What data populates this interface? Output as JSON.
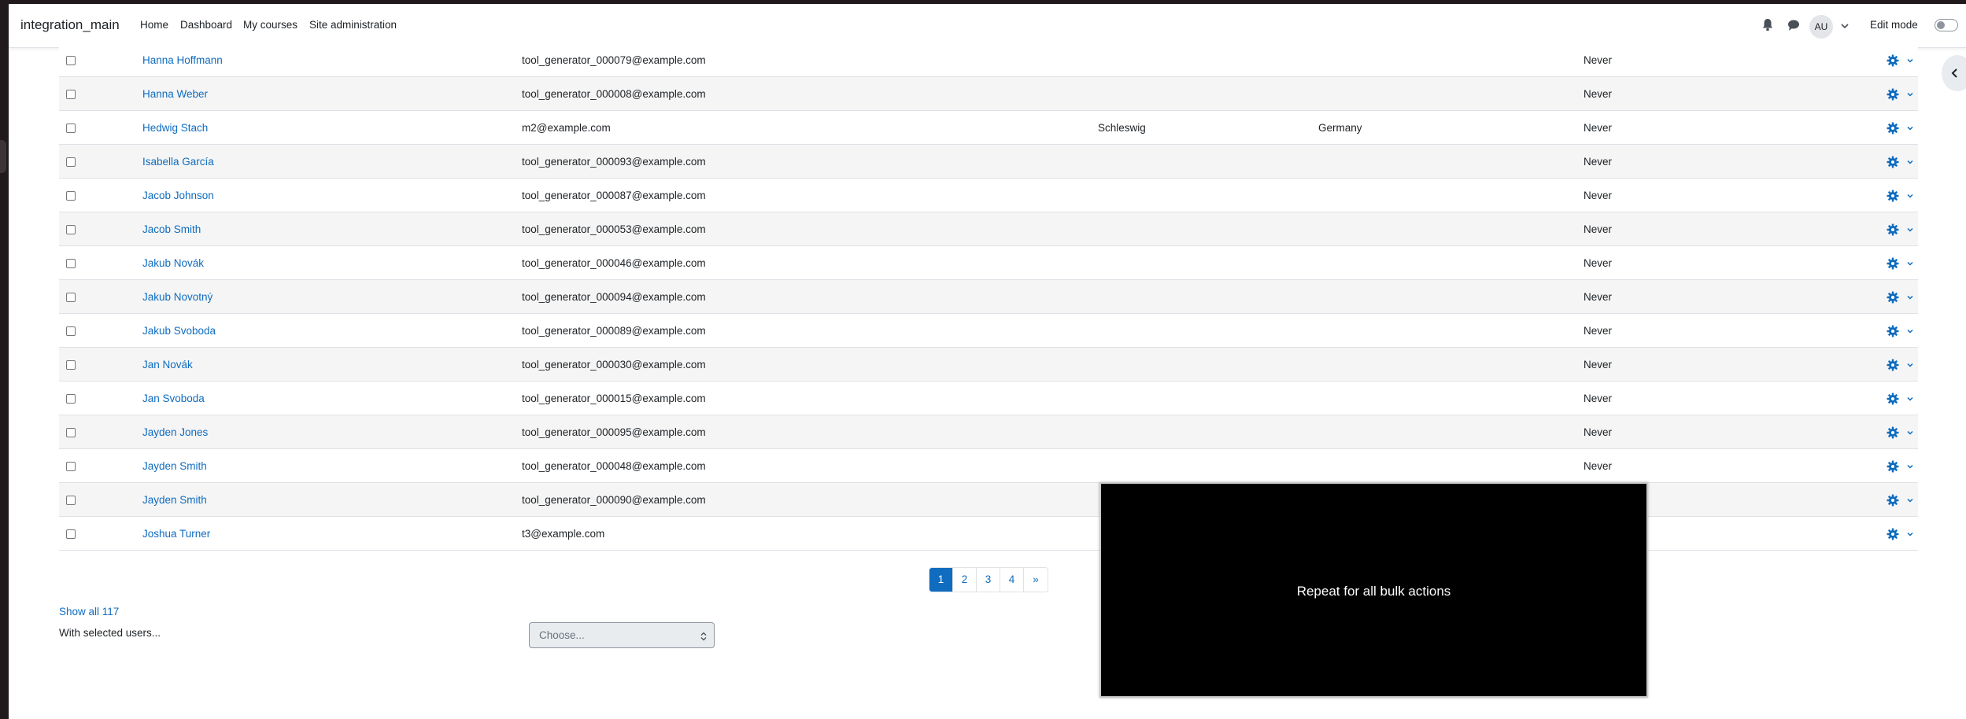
{
  "navbar": {
    "brand": "integration_main",
    "items": [
      "Home",
      "Dashboard",
      "My courses",
      "Site administration"
    ],
    "active_item": "Site administration",
    "avatar_initials": "AU",
    "edit_mode_label": "Edit mode",
    "edit_mode_on": false
  },
  "users": [
    {
      "name": "Hanna Hoffmann",
      "email": "tool_generator_000079@example.com",
      "city": "",
      "country": "",
      "last_access": "Never"
    },
    {
      "name": "Hanna Weber",
      "email": "tool_generator_000008@example.com",
      "city": "",
      "country": "",
      "last_access": "Never"
    },
    {
      "name": "Hedwig Stach",
      "email": "m2@example.com",
      "city": "Schleswig",
      "country": "Germany",
      "last_access": "Never"
    },
    {
      "name": "Isabella García",
      "email": "tool_generator_000093@example.com",
      "city": "",
      "country": "",
      "last_access": "Never"
    },
    {
      "name": "Jacob Johnson",
      "email": "tool_generator_000087@example.com",
      "city": "",
      "country": "",
      "last_access": "Never"
    },
    {
      "name": "Jacob Smith",
      "email": "tool_generator_000053@example.com",
      "city": "",
      "country": "",
      "last_access": "Never"
    },
    {
      "name": "Jakub Novák",
      "email": "tool_generator_000046@example.com",
      "city": "",
      "country": "",
      "last_access": "Never"
    },
    {
      "name": "Jakub Novotný",
      "email": "tool_generator_000094@example.com",
      "city": "",
      "country": "",
      "last_access": "Never"
    },
    {
      "name": "Jakub Svoboda",
      "email": "tool_generator_000089@example.com",
      "city": "",
      "country": "",
      "last_access": "Never"
    },
    {
      "name": "Jan Novák",
      "email": "tool_generator_000030@example.com",
      "city": "",
      "country": "",
      "last_access": "Never"
    },
    {
      "name": "Jan Svoboda",
      "email": "tool_generator_000015@example.com",
      "city": "",
      "country": "",
      "last_access": "Never"
    },
    {
      "name": "Jayden Jones",
      "email": "tool_generator_000095@example.com",
      "city": "",
      "country": "",
      "last_access": "Never"
    },
    {
      "name": "Jayden Smith",
      "email": "tool_generator_000048@example.com",
      "city": "",
      "country": "",
      "last_access": "Never"
    },
    {
      "name": "Jayden Smith",
      "email": "tool_generator_000090@example.com",
      "city": "",
      "country": "",
      "last_access": ""
    },
    {
      "name": "Joshua Turner",
      "email": "t3@example.com",
      "city": "",
      "country": "",
      "last_access": ""
    }
  ],
  "pagination": {
    "pages": [
      "1",
      "2",
      "3",
      "4",
      "»"
    ],
    "current": "1"
  },
  "footer": {
    "show_all": "Show all 117",
    "with_selected": "With selected users...",
    "bulk_select_value": "Choose..."
  },
  "overlay": {
    "text": "Repeat for all bulk actions"
  },
  "colors": {
    "link": "#0f6cbf",
    "overlay_bg": "#000000"
  }
}
